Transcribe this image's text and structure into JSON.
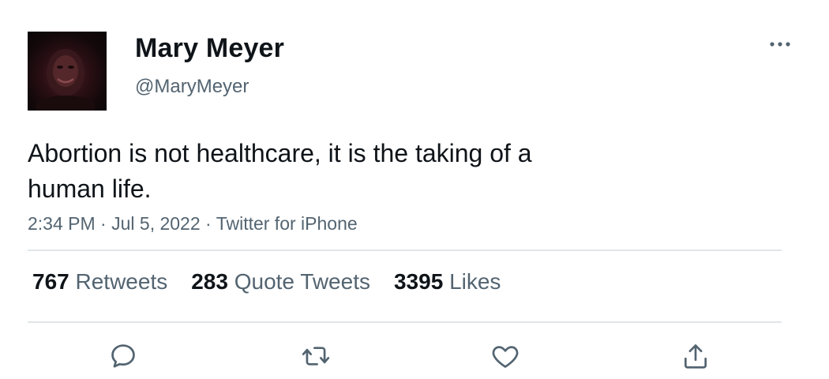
{
  "user": {
    "display_name": "Mary Meyer",
    "handle": "@MaryMeyer"
  },
  "tweet": {
    "text": "Abortion is not healthcare, it is the taking of a human life.",
    "time": "2:34 PM",
    "separator": "·",
    "date": "Jul 5, 2022",
    "source": "Twitter for iPhone"
  },
  "stats": {
    "retweets": {
      "count": "767",
      "label": "Retweets"
    },
    "quotes": {
      "count": "283",
      "label": "Quote Tweets"
    },
    "likes": {
      "count": "3395",
      "label": "Likes"
    }
  },
  "icons": {
    "more": "more-horizontal-icon",
    "reply": "reply-icon",
    "retweet": "retweet-icon",
    "like": "heart-icon",
    "share": "share-icon"
  },
  "colors": {
    "text": "#0f1419",
    "secondary": "#536471",
    "divider": "#e1e6ea"
  }
}
